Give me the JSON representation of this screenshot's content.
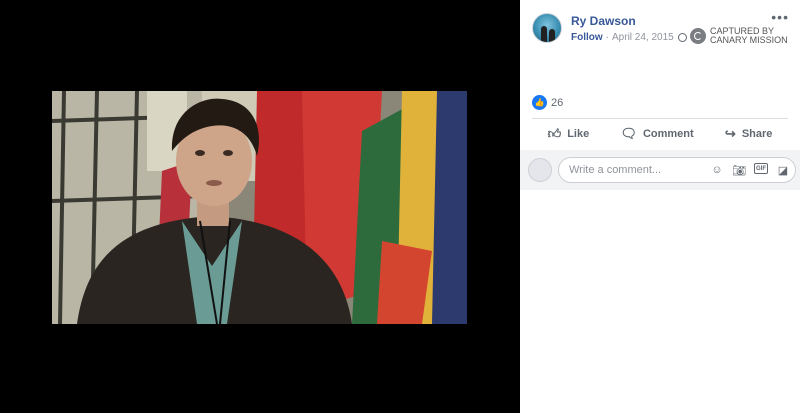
{
  "post": {
    "author": "Ry Dawson",
    "follow_label": "Follow",
    "separator": "·",
    "date": "April 24, 2015",
    "privacy_icon": "globe-icon",
    "more_icon": "more-options-icon"
  },
  "watermark": {
    "line1": "CAPTURED BY",
    "line2": "CANARY MISSION"
  },
  "reactions": {
    "icon": "like-reaction-icon",
    "count": "26"
  },
  "actions": [
    {
      "label": "Like",
      "icon": "thumbs-up-icon"
    },
    {
      "label": "Comment",
      "icon": "comment-bubble-icon"
    },
    {
      "label": "Share",
      "icon": "share-arrow-icon"
    }
  ],
  "comment": {
    "placeholder": "Write a comment...",
    "icons": [
      "emoji-icon",
      "camera-icon",
      "gif-icon",
      "sticker-icon"
    ]
  },
  "colors": {
    "brand": "#385898",
    "like_blue": "#1877f2",
    "muted": "#90949c",
    "viewer_bg": "#000000"
  }
}
